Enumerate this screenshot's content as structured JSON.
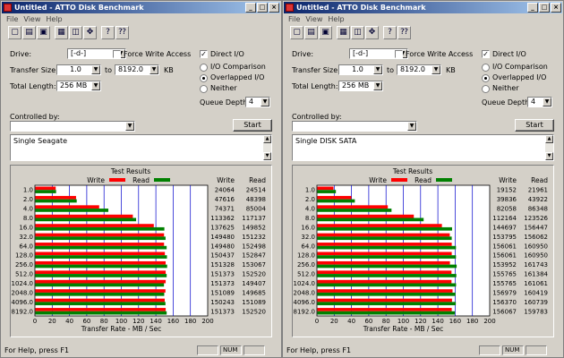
{
  "windows": [
    {
      "title": "Untitled - ATTO Disk Benchmark",
      "menu": [
        "File",
        "View",
        "Help"
      ],
      "drive_label": "Drive:",
      "drive_value": "[-d-]",
      "force_write_access_label": "Force Write Access",
      "force_write_access_checked": false,
      "direct_io_label": "Direct I/O",
      "direct_io_checked": true,
      "transfer_size_label": "Transfer Size:",
      "transfer_from": "1.0",
      "transfer_to_label": "to",
      "transfer_to": "8192.0",
      "transfer_unit": "KB",
      "total_length_label": "Total Length:",
      "total_length_value": "256 MB",
      "radio_io_comparison": "I/O Comparison",
      "radio_overlapped": "Overlapped I/O",
      "radio_neither": "Neither",
      "selected_radio": "overlapped",
      "queue_depth_label": "Queue Depth:",
      "queue_depth_value": "4",
      "controlled_by_label": "Controlled by:",
      "controlled_by_value": "",
      "start_label": "Start",
      "description": "Single Seagate",
      "status_help": "For Help, press F1",
      "status_num": "NUM",
      "chart_data": {
        "type": "bar",
        "title": "Test Results",
        "xlabel": "Transfer Rate - MB / Sec",
        "xlim": [
          0,
          200
        ],
        "xticks": [
          "0",
          "20",
          "40",
          "60",
          "80",
          "100",
          "120",
          "140",
          "160",
          "180",
          "200"
        ],
        "legend_write": "Write",
        "legend_read": "Read",
        "write_color": "#ff0000",
        "read_color": "#008000",
        "col_write": "Write",
        "col_read": "Read",
        "categories": [
          "1.0",
          "2.0",
          "4.0",
          "8.0",
          "16.0",
          "32.0",
          "64.0",
          "128.0",
          "256.0",
          "512.0",
          "1024.0",
          "2048.0",
          "4096.0",
          "8192.0"
        ],
        "series": [
          {
            "name": "Write",
            "values": [
              24064,
              47616,
              74371,
              113362,
              137625,
              149480,
              149480,
              150437,
              151328,
              151373,
              151373,
              151089,
              150243,
              151373
            ]
          },
          {
            "name": "Read",
            "values": [
              24514,
              48398,
              85004,
              117137,
              149852,
              151232,
              152498,
              152847,
              153067,
              152520,
              149407,
              149685,
              151089,
              152520
            ]
          }
        ]
      }
    },
    {
      "title": "Untitled - ATTO Disk Benchmark",
      "menu": [
        "File",
        "View",
        "Help"
      ],
      "drive_label": "Drive:",
      "drive_value": "[-d-]",
      "force_write_access_label": "Force Write Access",
      "force_write_access_checked": false,
      "direct_io_label": "Direct I/O",
      "direct_io_checked": true,
      "transfer_size_label": "Transfer Size:",
      "transfer_from": "1.0",
      "transfer_to_label": "to",
      "transfer_to": "8192.0",
      "transfer_unit": "KB",
      "total_length_label": "Total Length:",
      "total_length_value": "256 MB",
      "radio_io_comparison": "I/O Comparison",
      "radio_overlapped": "Overlapped I/O",
      "radio_neither": "Neither",
      "selected_radio": "overlapped",
      "queue_depth_label": "Queue Depth:",
      "queue_depth_value": "4",
      "controlled_by_label": "Controlled by:",
      "controlled_by_value": "",
      "start_label": "Start",
      "description": "Single DISK SATA",
      "status_help": "For Help, press F1",
      "status_num": "NUM",
      "chart_data": {
        "type": "bar",
        "title": "Test Results",
        "xlabel": "Transfer Rate - MB / Sec",
        "xlim": [
          0,
          200
        ],
        "xticks": [
          "0",
          "20",
          "40",
          "60",
          "80",
          "100",
          "120",
          "140",
          "160",
          "180",
          "200"
        ],
        "legend_write": "Write",
        "legend_read": "Read",
        "write_color": "#ff0000",
        "read_color": "#008000",
        "col_write": "Write",
        "col_read": "Read",
        "categories": [
          "1.0",
          "2.0",
          "4.0",
          "8.0",
          "16.0",
          "32.0",
          "64.0",
          "128.0",
          "256.0",
          "512.0",
          "1024.0",
          "2048.0",
          "4096.0",
          "8192.0"
        ],
        "series": [
          {
            "name": "Write",
            "values": [
              19152,
              39836,
              82058,
              112164,
              144697,
              153795,
              156061,
              156061,
              153952,
              155765,
              155765,
              156979,
              156370,
              156067
            ]
          },
          {
            "name": "Read",
            "values": [
              21961,
              43922,
              86348,
              123526,
              156447,
              156062,
              160950,
              160950,
              161743,
              161384,
              161061,
              160419,
              160739,
              159783
            ]
          }
        ]
      }
    }
  ]
}
